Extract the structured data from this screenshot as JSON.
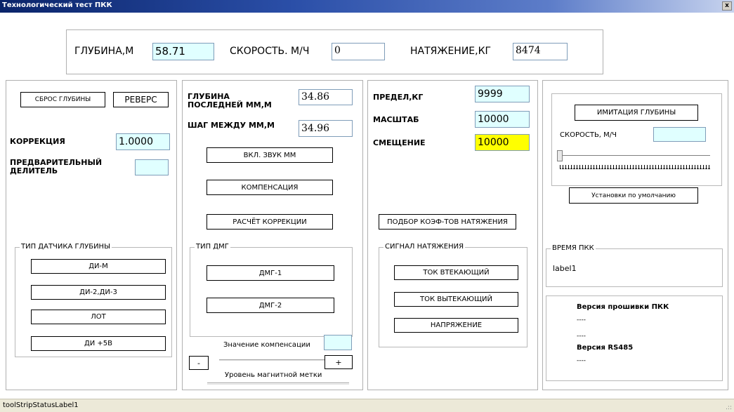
{
  "window": {
    "title": "Технологический тест ПКК",
    "close_glyph": "x"
  },
  "top": {
    "depth_label": "ГЛУБИНА,М",
    "depth_value": "58.71",
    "speed_label": "СКОРОСТЬ. М/Ч",
    "speed_value": "0",
    "tension_label": "НАТЯЖЕНИЕ,КГ",
    "tension_value": "8474"
  },
  "panel1": {
    "reset_depth": "СБРОС ГЛУБИНЫ",
    "reverse": "РЕВЕРС",
    "correction_label": "КОРРЕКЦИЯ",
    "correction_value": "1.0000",
    "predivider_label_line1": "ПРЕДВАРИТЕЛЬНЫЙ",
    "predivider_label_line2": "ДЕЛИТЕЛЬ",
    "predivider_value": "",
    "sensor_group": "ТИП ДАТЧИКА ГЛУБИНЫ",
    "sensors": [
      "ДИ-М",
      "ДИ-2,ДИ-3",
      "ЛОТ",
      "ДИ +5В"
    ]
  },
  "panel2": {
    "depth_last_label_line1": "ГЛУБИНА",
    "depth_last_label_line2": "ПОСЛЕДНЕЙ ММ,М",
    "depth_last_value": "34.86",
    "step_label": "ШАГ МЕЖДУ ММ,М",
    "step_value": "34.96",
    "sound_btn": "ВКЛ. ЗВУК ММ",
    "compensation_btn": "КОМПЕНСАЦИЯ",
    "calc_correction_btn": "РАСЧЁТ КОРРЕКЦИИ",
    "dmg_group": "ТИП ДМГ",
    "dmg_buttons": [
      "ДМГ-1",
      "ДМГ-2"
    ],
    "comp_value_label": "Значение компенсации",
    "comp_value": "",
    "minus": "-",
    "plus": "+",
    "mark_level_label": "Уровень магнитной метки"
  },
  "panel3": {
    "limit_label": "ПРЕДЕЛ,КГ",
    "limit_value": "9999",
    "scale_label": "МАСШТАБ",
    "scale_value": "10000",
    "offset_label": "СМЕЩЕНИЕ",
    "offset_value": "10000",
    "coef_btn": "ПОДБОР КОЭФ-ТОВ НАТЯЖЕНИЯ",
    "signal_group": "СИГНАЛ НАТЯЖЕНИЯ",
    "signals": [
      "ТОК ВТЕКАЮЩИЙ",
      "ТОК ВЫТЕКАЮЩИЙ",
      "НАПРЯЖЕНИЕ"
    ]
  },
  "panel4": {
    "imitation_btn": "ИМИТАЦИЯ ГЛУБИНЫ",
    "speed_label": "СКОРОСТЬ, М/Ч",
    "speed_value": "",
    "slider_fraction": 0,
    "defaults_btn": "Установки по умолчанию",
    "time_group": "ВРЕМЯ ПКК",
    "time_value": "label1",
    "fw_title": "Версия прошивки ПКК",
    "fw_line1": "----",
    "fw_line2": "----",
    "rs485_title": "Версия RS485",
    "rs485_line1": "----"
  },
  "status": {
    "text": "toolStripStatusLabel1",
    "grip": ".::"
  }
}
